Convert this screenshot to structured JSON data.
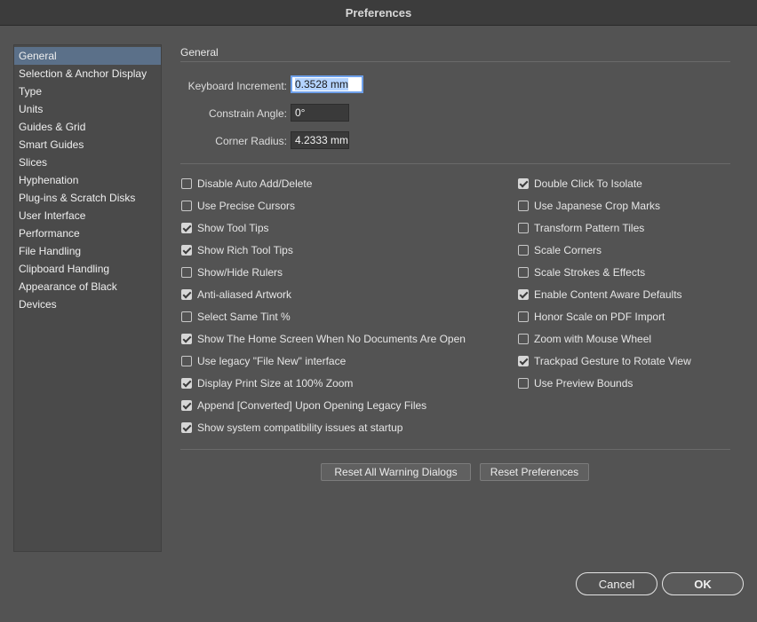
{
  "window": {
    "title": "Preferences"
  },
  "sidebar": {
    "items": [
      {
        "label": "General",
        "selected": true
      },
      {
        "label": "Selection & Anchor Display"
      },
      {
        "label": "Type"
      },
      {
        "label": "Units"
      },
      {
        "label": "Guides & Grid"
      },
      {
        "label": "Smart Guides"
      },
      {
        "label": "Slices"
      },
      {
        "label": "Hyphenation"
      },
      {
        "label": "Plug-ins & Scratch Disks"
      },
      {
        "label": "User Interface"
      },
      {
        "label": "Performance"
      },
      {
        "label": "File Handling"
      },
      {
        "label": "Clipboard Handling"
      },
      {
        "label": "Appearance of Black"
      },
      {
        "label": "Devices"
      }
    ]
  },
  "general": {
    "section_title": "General",
    "keyboard_increment": {
      "label": "Keyboard Increment:",
      "value": "0.3528 mm"
    },
    "constrain_angle": {
      "label": "Constrain Angle:",
      "value": "0°"
    },
    "corner_radius": {
      "label": "Corner Radius:",
      "value": "4.2333 mm"
    }
  },
  "options_left": [
    {
      "label": "Disable Auto Add/Delete",
      "checked": false
    },
    {
      "label": "Use Precise Cursors",
      "checked": false
    },
    {
      "label": "Show Tool Tips",
      "checked": true
    },
    {
      "label": "Show Rich Tool Tips",
      "checked": true
    },
    {
      "label": "Show/Hide Rulers",
      "checked": false
    },
    {
      "label": "Anti-aliased Artwork",
      "checked": true
    },
    {
      "label": "Select Same Tint %",
      "checked": false
    },
    {
      "label": "Show The Home Screen When No Documents Are Open",
      "checked": true
    },
    {
      "label": "Use legacy \"File New\" interface",
      "checked": false
    },
    {
      "label": "Display Print Size at 100% Zoom",
      "checked": true
    },
    {
      "label": "Append [Converted] Upon Opening Legacy Files",
      "checked": true
    },
    {
      "label": "Show system compatibility issues at startup",
      "checked": true
    }
  ],
  "options_right": [
    {
      "label": "Double Click To Isolate",
      "checked": true
    },
    {
      "label": "Use Japanese Crop Marks",
      "checked": false
    },
    {
      "label": "Transform Pattern Tiles",
      "checked": false
    },
    {
      "label": "Scale Corners",
      "checked": false
    },
    {
      "label": "Scale Strokes & Effects",
      "checked": false
    },
    {
      "label": "Enable Content Aware Defaults",
      "checked": true
    },
    {
      "label": "Honor Scale on PDF Import",
      "checked": false
    },
    {
      "label": "Zoom with Mouse Wheel",
      "checked": false
    },
    {
      "label": "Trackpad Gesture to Rotate View",
      "checked": true
    },
    {
      "label": "Use Preview Bounds",
      "checked": false
    }
  ],
  "buttons": {
    "reset_warnings": "Reset All Warning Dialogs",
    "reset_preferences": "Reset Preferences",
    "cancel": "Cancel",
    "ok": "OK"
  },
  "colors": {
    "background": "#535353",
    "selected_item": "#5b7089",
    "focus_ring": "#6ea0ea"
  }
}
